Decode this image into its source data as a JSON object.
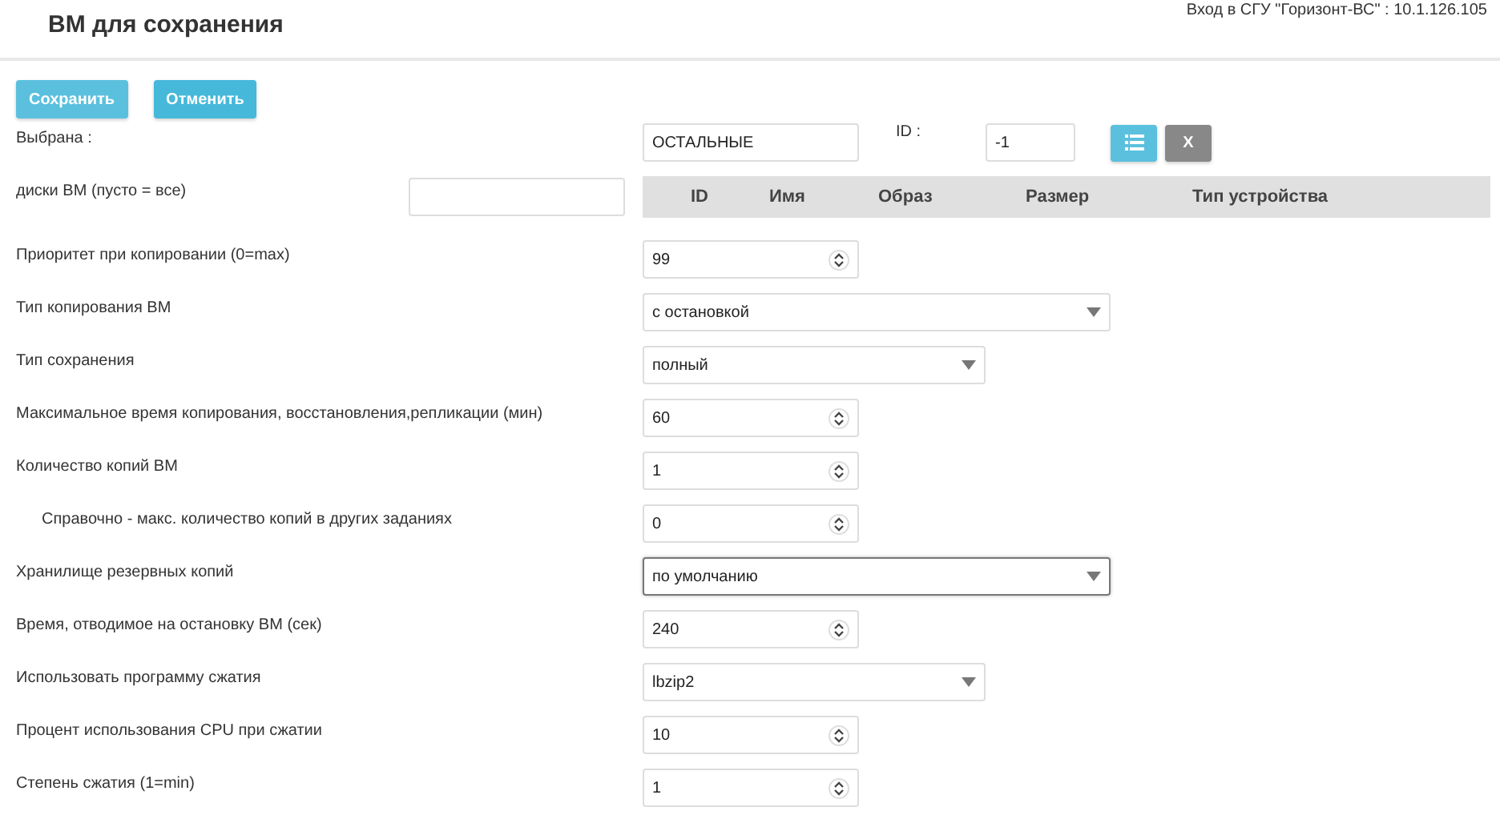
{
  "header": {
    "title": "ВМ для сохранения",
    "login": "Вход в СГУ \"Горизонт-ВС\" : 10.1.126.105"
  },
  "buttons": [
    {
      "label": "Сохранить",
      "kind": "primary"
    },
    {
      "label": "Отменить",
      "kind": "info"
    }
  ],
  "selected_row": {
    "label": "Выбрана :",
    "value": "ОСТАЛЬНЫЕ",
    "id_label": "ID :",
    "id_value": "-1",
    "list_button": {
      "kind": "list"
    },
    "clear_button": {
      "label": "X"
    }
  },
  "disks_row": {
    "label": "диски ВМ (пусто = все)",
    "columns": [
      "ID",
      "Имя",
      "Образ",
      "Размер",
      "Тип устройства"
    ]
  },
  "rows": [
    {
      "label": "Приоритет при копировании (0=max)",
      "kind": "number",
      "value": "99"
    },
    {
      "label": "Тип копирования ВМ",
      "kind": "wideselect",
      "value": "с остановкой",
      "focused": false
    },
    {
      "label": "Тип сохранения",
      "kind": "select",
      "value": "полный",
      "focused": false
    },
    {
      "label": "Максимальное время копирования, восстановления,репликации (мин)",
      "kind": "number",
      "value": "60"
    },
    {
      "label": "Количество копий ВМ",
      "kind": "number",
      "value": "1",
      "children": [
        {
          "label": "Справочно - макс. количество копий в других заданиях",
          "kind": "number",
          "value": "0"
        }
      ]
    },
    {
      "label": "Хранилище резервных копий",
      "kind": "wideselect",
      "value": "по умолчанию",
      "focused": true
    },
    {
      "label": "Время, отводимое на остановку ВМ (сек)",
      "kind": "number",
      "value": "240"
    },
    {
      "label": "Использовать программу сжатия",
      "kind": "select",
      "value": "lbzip2",
      "focused": false
    },
    {
      "label": "Процент использования CPU при сжатии",
      "kind": "number",
      "value": "10"
    },
    {
      "label": "Степень сжатия (1=min)",
      "kind": "number",
      "value": "1"
    }
  ]
}
